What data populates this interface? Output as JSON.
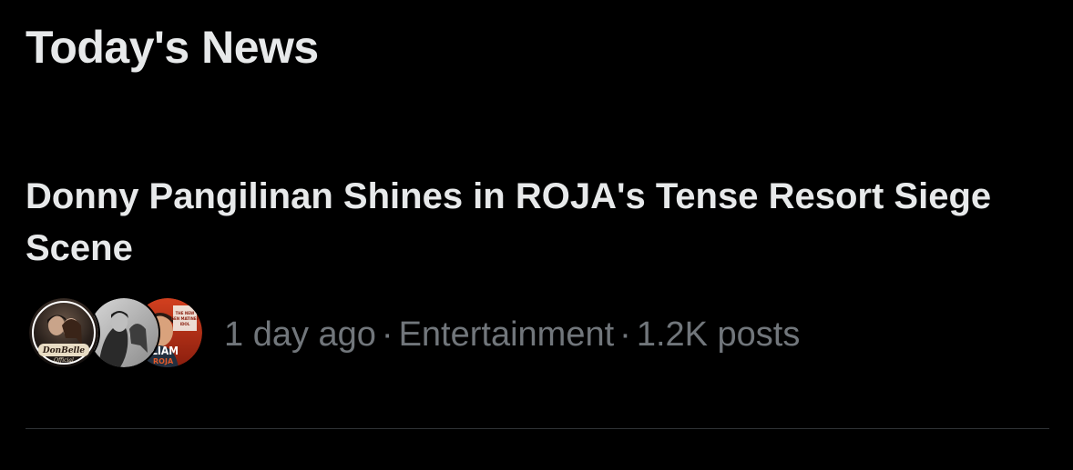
{
  "section": {
    "title": "Today's News"
  },
  "news_item": {
    "headline": "Donny Pangilinan Shines in ROJA's Tense Resort Siege Scene",
    "time": "1 day ago",
    "category": "Entertainment",
    "posts": "1.2K posts",
    "separator": "·",
    "avatars": [
      {
        "name": "donbelle-avatar",
        "text_top": "DonBelle",
        "text_bottom": "Official"
      },
      {
        "name": "couple-photo-avatar"
      },
      {
        "name": "roja-poster-avatar",
        "text_main": "LIAM",
        "text_sub": "ROJA",
        "text_corner": "THE NEW GEN MATINEE IDOL"
      }
    ]
  },
  "colors": {
    "background": "#000000",
    "primary_text": "#e7e9ea",
    "secondary_text": "#71767b",
    "divider": "#2f3336"
  }
}
